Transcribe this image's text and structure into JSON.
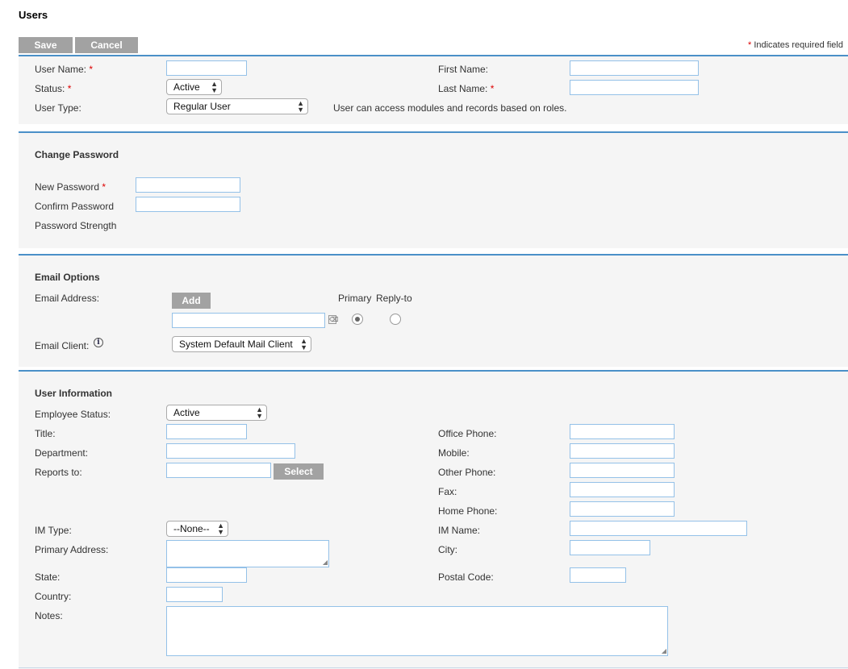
{
  "page": {
    "title": "Users"
  },
  "toolbar": {
    "save_label": "Save",
    "cancel_label": "Cancel",
    "required_note": "Indicates required field",
    "required_mark": "*"
  },
  "basic": {
    "user_name_label": "User Name:",
    "status_label": "Status:",
    "status_value": "Active",
    "user_type_label": "User Type:",
    "user_type_value": "Regular User",
    "user_type_help": "User can access modules and records based on roles.",
    "first_name_label": "First Name:",
    "last_name_label": "Last Name:",
    "user_name_value": "",
    "first_name_value": "",
    "last_name_value": ""
  },
  "password": {
    "title": "Change Password",
    "new_label": "New Password",
    "confirm_label": "Confirm Password",
    "strength_label": "Password Strength"
  },
  "email": {
    "title": "Email Options",
    "address_label": "Email Address:",
    "add_label": "Add",
    "primary_label": "Primary",
    "reply_to_label": "Reply-to",
    "client_label": "Email Client:",
    "client_value": "System Default Mail Client",
    "primary_selected": true,
    "reply_to_selected": false
  },
  "info": {
    "title": "User Information",
    "employee_status_label": "Employee Status:",
    "employee_status_value": "Active",
    "title_label": "Title:",
    "department_label": "Department:",
    "reports_to_label": "Reports to:",
    "select_label": "Select",
    "office_phone_label": "Office Phone:",
    "mobile_label": "Mobile:",
    "other_phone_label": "Other Phone:",
    "fax_label": "Fax:",
    "home_phone_label": "Home Phone:",
    "im_type_label": "IM Type:",
    "im_type_value": "--None--",
    "im_name_label": "IM Name:",
    "primary_address_label": "Primary Address:",
    "city_label": "City:",
    "state_label": "State:",
    "postal_code_label": "Postal Code:",
    "country_label": "Country:",
    "notes_label": "Notes:"
  },
  "icons": {
    "info": "info-icon",
    "trash": "trash-icon",
    "select_arrows": "updown-arrows-icon"
  },
  "colors": {
    "accent": "#4a90c8",
    "button": "#a2a2a2",
    "required": "#dd0000",
    "panel": "#f5f5f5"
  }
}
